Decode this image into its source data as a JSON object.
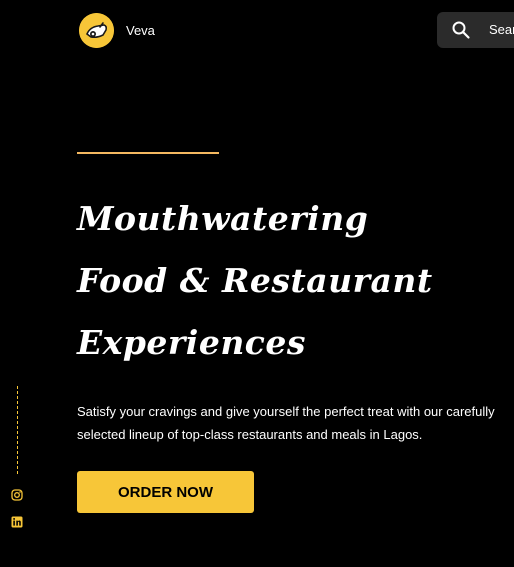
{
  "header": {
    "brand": "Veva",
    "search_label": "Search",
    "icons": {
      "logo": "veva-logo-icon",
      "search": "search-icon"
    }
  },
  "hero": {
    "title_lines": [
      "Mouthwatering",
      "Food & Restaurant",
      "Experiences"
    ],
    "subtitle_line1": "Satisfy your cravings and give yourself the perfect treat with our carefully",
    "subtitle_line2": "selected lineup of top-class restaurants and meals in Lagos.",
    "cta_label": "ORDER NOW"
  },
  "social": {
    "icons": [
      "instagram-icon",
      "linkedin-icon"
    ]
  },
  "colors": {
    "background": "#000000",
    "accent": "#f7c638",
    "accent_line": "#f4b860",
    "search_bg": "#2b2b2b"
  }
}
